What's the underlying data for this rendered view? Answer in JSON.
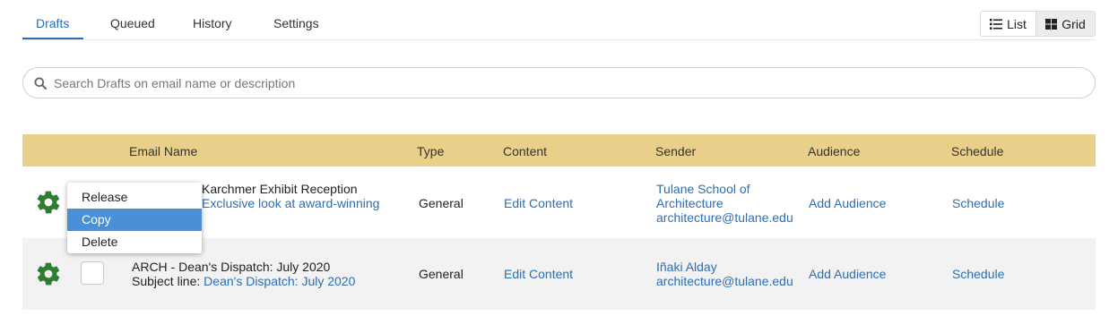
{
  "tabs": [
    {
      "label": "Drafts",
      "active": true
    },
    {
      "label": "Queued",
      "active": false
    },
    {
      "label": "History",
      "active": false
    },
    {
      "label": "Settings",
      "active": false
    }
  ],
  "view_toggle": {
    "list_label": "List",
    "grid_label": "Grid",
    "selected": "Grid"
  },
  "search": {
    "placeholder": "Search Drafts on email name or description",
    "value": ""
  },
  "table": {
    "headers": [
      "Email Name",
      "Type",
      "Content",
      "Sender",
      "Audience",
      "Schedule"
    ],
    "rows": [
      {
        "name_visible": "Karchmer Exhibit Reception",
        "subject_visible": "Exclusive look at award-winning",
        "type": "General",
        "content": "Edit Content",
        "sender_name_line1": "Tulane School of",
        "sender_name_line2": "Architecture",
        "sender_email": "architecture@tulane.edu",
        "audience": "Add Audience",
        "schedule": "Schedule"
      },
      {
        "name": "ARCH - Dean's Dispatch: July 2020",
        "subject_label": "Subject line:",
        "subject": "Dean's Dispatch: July 2020",
        "type": "General",
        "content": "Edit Content",
        "sender_name": "Iñaki Alday",
        "sender_email": "architecture@tulane.edu",
        "audience": "Add Audience",
        "schedule": "Schedule"
      }
    ]
  },
  "context_menu": {
    "items": [
      {
        "label": "Release",
        "highlighted": false
      },
      {
        "label": "Copy",
        "highlighted": true
      },
      {
        "label": "Delete",
        "highlighted": false
      }
    ]
  },
  "colors": {
    "accent": "#2a6fb5",
    "header_bg": "#e9cf89",
    "gear": "#2e7d32",
    "menu_highlight": "#4a90d9"
  }
}
